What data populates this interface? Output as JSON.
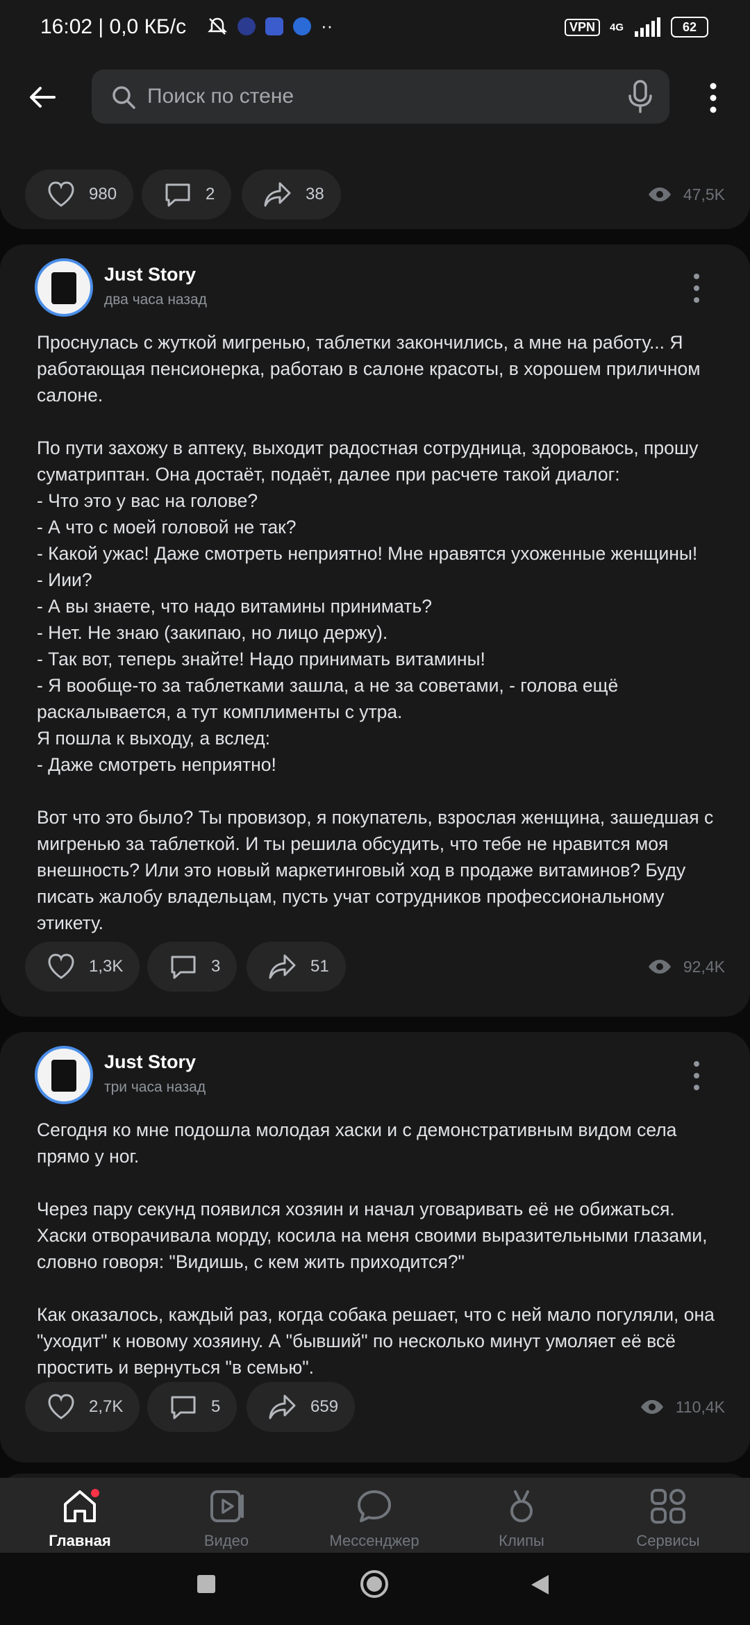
{
  "status_bar": {
    "time_speed": "16:02 | 0,0 КБ/с",
    "vpn": "VPN",
    "network": "4G",
    "battery": "62"
  },
  "search": {
    "placeholder": "Поиск по стене"
  },
  "posts": [
    {
      "likes": "980",
      "comments": "2",
      "shares": "38",
      "views": "47,5K"
    },
    {
      "author": "Just Story",
      "time": "два часа назад",
      "paragraphs": [
        [
          "Проснулась с жуткой мигренью, таблетки закончились, а мне на работу... Я работающая пенсионерка, работаю в салоне красоты, в хорошем приличном салоне."
        ],
        [
          "По пути захожу в аптеку, выходит радостная сотрудница, здороваюсь, прошу суматриптан. Она достаёт, подаёт, далее при расчете такой диалог:",
          "- Что это у вас на голове?",
          "- А что с моей головой не так?",
          "- Какой ужас! Даже смотреть неприятно! Мне нравятся ухоженные женщины!",
          "- Иии?",
          "- А вы знаете, что надо витамины принимать?",
          "- Нет. Не знаю (закипаю, но лицо держу).",
          "- Так вот, теперь знайте! Надо принимать витамины!",
          "- Я вообще-то за таблетками зашла, а не за советами, - голова ещё раскалывается, а тут комплименты с утра.",
          "Я пошла к выходу, а вслед:",
          "- Даже смотреть неприятно!"
        ],
        [
          "Вот что это было? Ты провизор, я покупатель, взрослая женщина, зашедшая с мигренью за таблеткой. И ты решила обсудить, что тебе не нравится моя внешность? Или это новый маркетинговый ход в продаже витаминов? Буду писать жалобу владельцам, пусть учат сотрудников профессиональному этикету."
        ]
      ],
      "likes": "1,3K",
      "comments": "3",
      "shares": "51",
      "views": "92,4K"
    },
    {
      "author": "Just Story",
      "time": "три часа назад",
      "paragraphs": [
        [
          "Сегодня ко мне подошла молодая хаски и с демонстративным видом села прямо у ног."
        ],
        [
          "Через пару секунд появился хозяин и начал уговаривать её не обижаться. Хаски отворачивала морду, косила на меня своими выразительными глазами, словно говоря: \"Видишь, с кем жить приходится?\""
        ],
        [
          "Как оказалось, каждый раз, когда собака решает, что с ней мало погуляли, она \"уходит\" к новому хозяину. А \"бывший\" по несколько минут умоляет её всё простить и вернуться \"в семью\"."
        ]
      ],
      "likes": "2,7K",
      "comments": "5",
      "shares": "659",
      "views": "110,4K"
    }
  ],
  "tabs": [
    {
      "label": "Главная",
      "icon": "home-icon",
      "active": true
    },
    {
      "label": "Видео",
      "icon": "video-icon"
    },
    {
      "label": "Мессенджер",
      "icon": "messenger-icon"
    },
    {
      "label": "Клипы",
      "icon": "clips-icon"
    },
    {
      "label": "Сервисы",
      "icon": "services-icon"
    }
  ],
  "colors": {
    "background": "#0a0a0a",
    "card": "#19191a",
    "accent": "#4a8ee8",
    "notification": "#ff3347"
  }
}
